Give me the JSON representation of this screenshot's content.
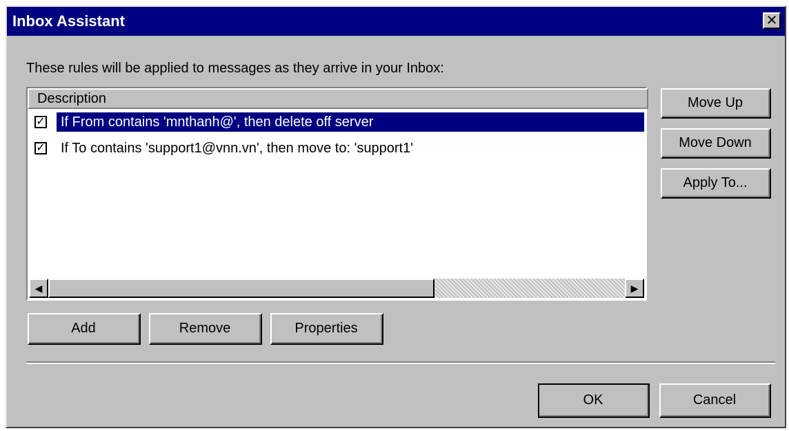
{
  "window": {
    "title": "Inbox Assistant",
    "close_label": "✕"
  },
  "intro_text": "These rules will be applied to messages as they arrive in your Inbox:",
  "list": {
    "column_header": "Description",
    "rows": [
      {
        "checked": true,
        "text": "If From contains 'mnthanh@', then delete off server",
        "selected": true
      },
      {
        "checked": true,
        "text": "If To contains 'support1@vnn.vn', then move to: 'support1'",
        "selected": false
      }
    ]
  },
  "side_buttons": {
    "move_up": "Move Up",
    "move_down": "Move Down",
    "apply_to": "Apply To..."
  },
  "bottom_buttons": {
    "add": "Add",
    "remove": "Remove",
    "properties": "Properties"
  },
  "dialog_buttons": {
    "ok": "OK",
    "cancel": "Cancel"
  },
  "colors": {
    "title_bar": "#000080",
    "selection": "#000080",
    "face": "#c0c0c0"
  }
}
